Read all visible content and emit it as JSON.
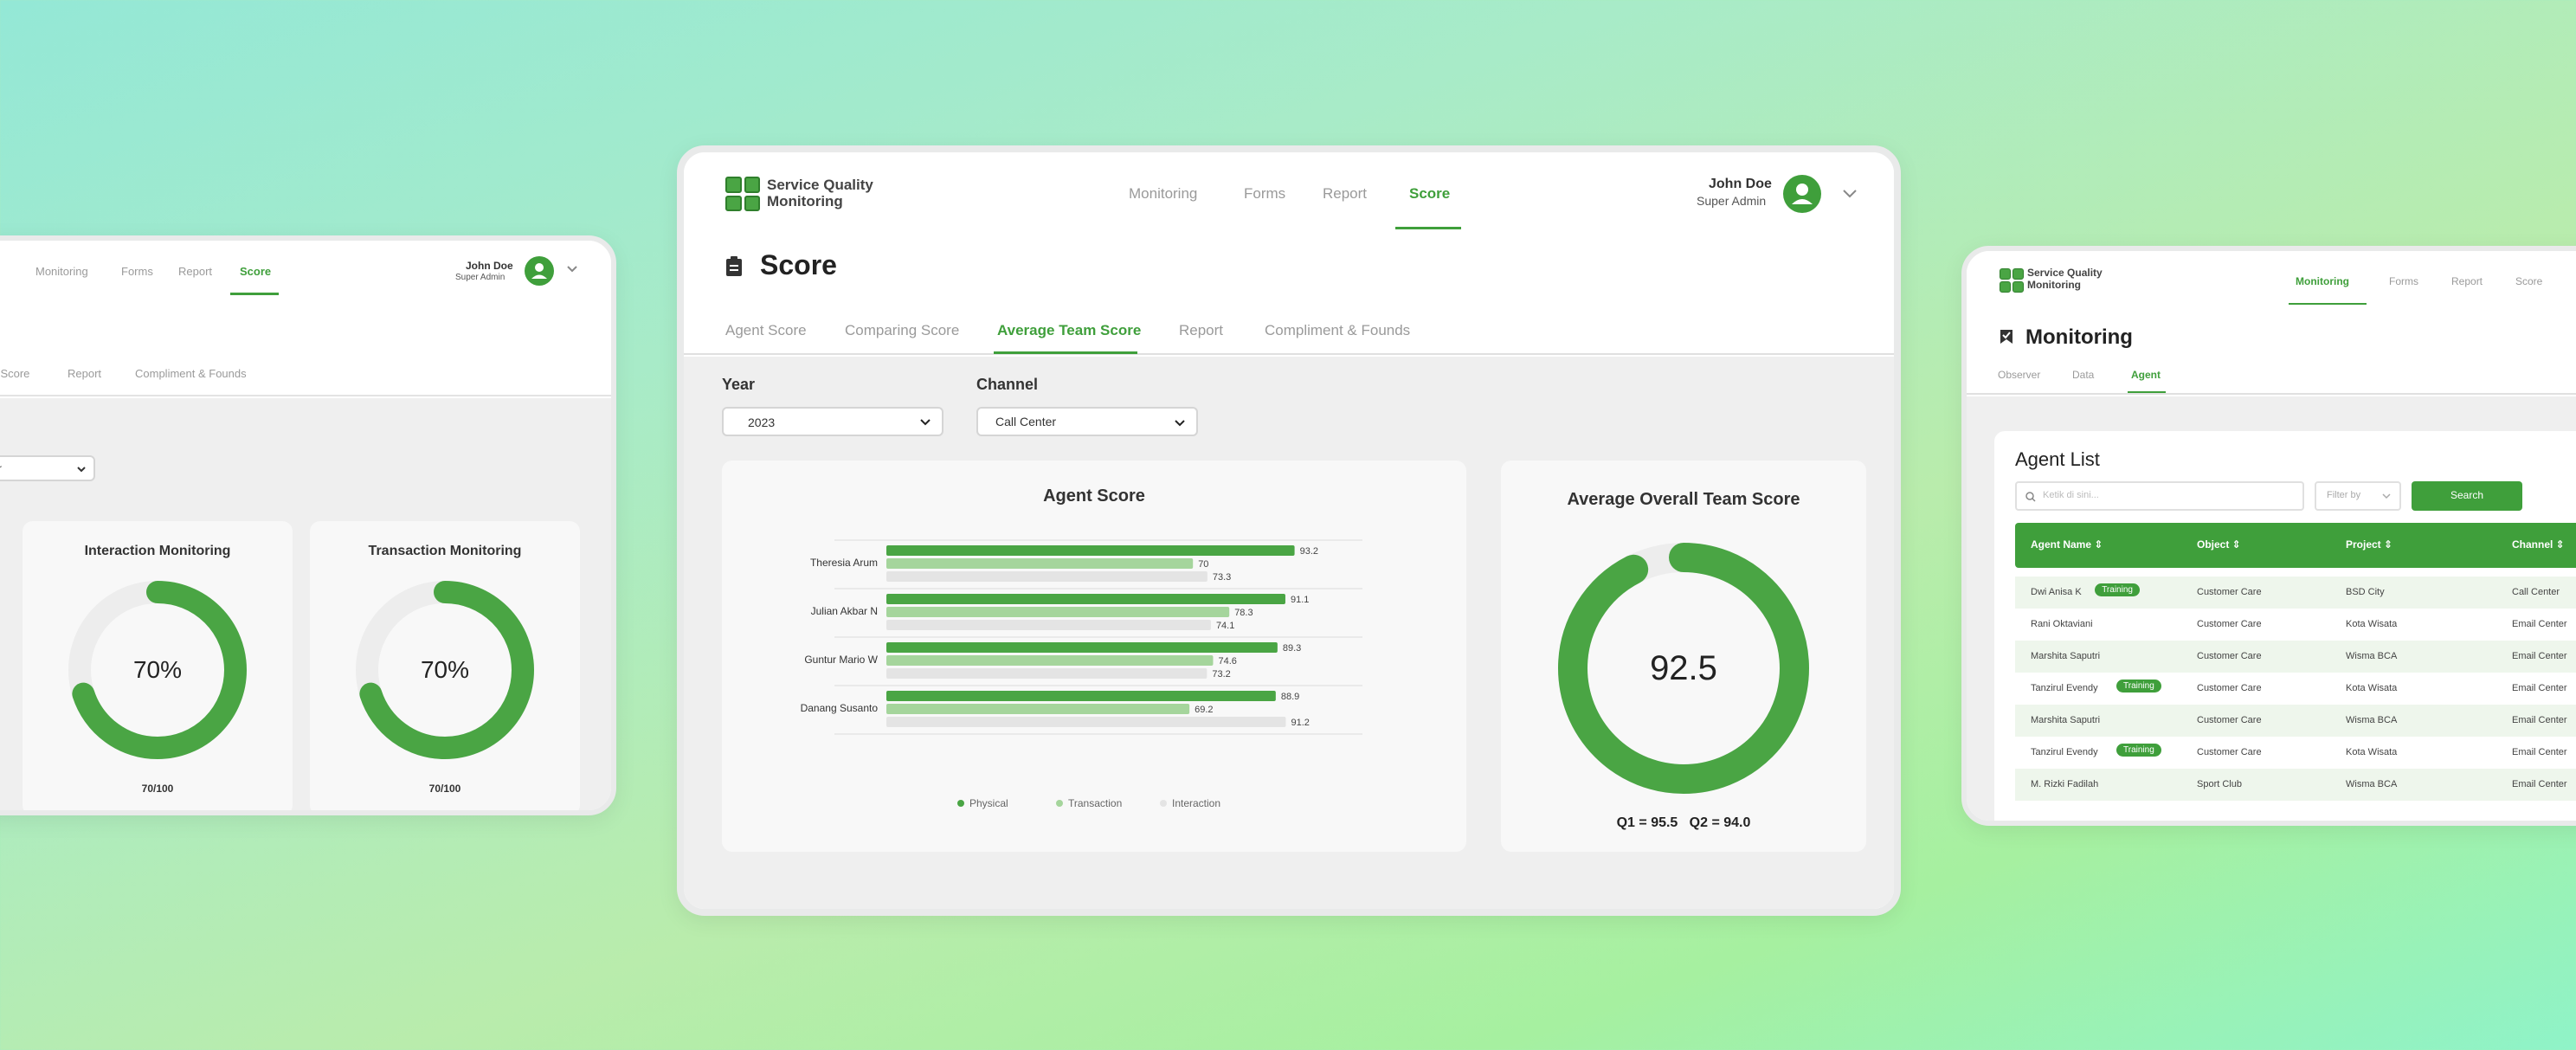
{
  "brand": {
    "name_line1": "Service Quality",
    "name_line2": "Monitoring"
  },
  "user": {
    "name": "John Doe",
    "role": "Super Admin"
  },
  "nav": {
    "monitoring": "Monitoring",
    "forms": "Forms",
    "report": "Report",
    "score": "Score"
  },
  "center": {
    "page_title": "Score",
    "tabs": [
      "Agent Score",
      "Comparing Score",
      "Average Team Score",
      "Report",
      "Compliment & Founds"
    ],
    "filters": {
      "year_label": "Year",
      "year_value": "2023",
      "channel_label": "Channel",
      "channel_value": "Call Center"
    },
    "agent_card_title": "Agent Score",
    "donut_card_title": "Average Overall Team Score",
    "donut_value": "92.5",
    "donut_fraction": 0.925,
    "quarters": "Q1 = 95.5   Q2 = 94.0"
  },
  "left": {
    "tabs": [
      "m Score",
      "Report",
      "Compliment & Founds"
    ],
    "dropdown_value": "r",
    "gauges": [
      {
        "title": "Interaction Monitoring",
        "value": "70%",
        "score": "70/100",
        "fraction": 0.7
      },
      {
        "title": "Transaction Monitoring",
        "value": "70%",
        "score": "70/100",
        "fraction": 0.7
      }
    ]
  },
  "right": {
    "page_title": "Monitoring",
    "tabs": [
      "Observer",
      "Data",
      "Agent"
    ],
    "list_title": "Agent List",
    "search_placeholder": "Ketik di sini...",
    "filter_placeholder": "Filter by",
    "search_button": "Search",
    "columns": [
      "Agent Name",
      "Object",
      "Project",
      "Channel"
    ],
    "badge": "Training",
    "rows": [
      {
        "name": "Dwi Anisa K",
        "training": true,
        "object": "Customer Care",
        "project": "BSD City",
        "channel": "Call Center"
      },
      {
        "name": "Rani Oktaviani",
        "training": false,
        "object": "Customer Care",
        "project": "Kota Wisata",
        "channel": "Email Center"
      },
      {
        "name": "Marshita Saputri",
        "training": false,
        "object": "Customer Care",
        "project": "Wisma BCA",
        "channel": "Email Center"
      },
      {
        "name": "Tanzirul Evendy",
        "training": true,
        "object": "Customer Care",
        "project": "Kota Wisata",
        "channel": "Email Center"
      },
      {
        "name": "Marshita Saputri",
        "training": false,
        "object": "Customer Care",
        "project": "Wisma BCA",
        "channel": "Email Center"
      },
      {
        "name": "Tanzirul Evendy",
        "training": true,
        "object": "Customer Care",
        "project": "Kota Wisata",
        "channel": "Email Center"
      },
      {
        "name": "M. Rizki Fadilah",
        "training": false,
        "object": "Sport Club",
        "project": "Wisma BCA",
        "channel": "Email Center"
      }
    ]
  },
  "colors": {
    "physical": "#4aa544",
    "transaction": "#a5d59c",
    "interaction": "#e4e4e4",
    "accent": "#3f9f3b"
  },
  "chart_data": {
    "type": "bar",
    "title": "Agent Score",
    "categories": [
      "Theresia Arum",
      "Julian Akbar N",
      "Guntur Mario W",
      "Danang Susanto"
    ],
    "series": [
      {
        "name": "Physical",
        "values": [
          93.2,
          91.1,
          89.3,
          88.9
        ]
      },
      {
        "name": "Transaction",
        "values": [
          70,
          78.3,
          74.6,
          69.2
        ]
      },
      {
        "name": "Interaction",
        "values": [
          73.3,
          74.1,
          73.2,
          91.2
        ]
      }
    ],
    "legend": "bottom"
  }
}
